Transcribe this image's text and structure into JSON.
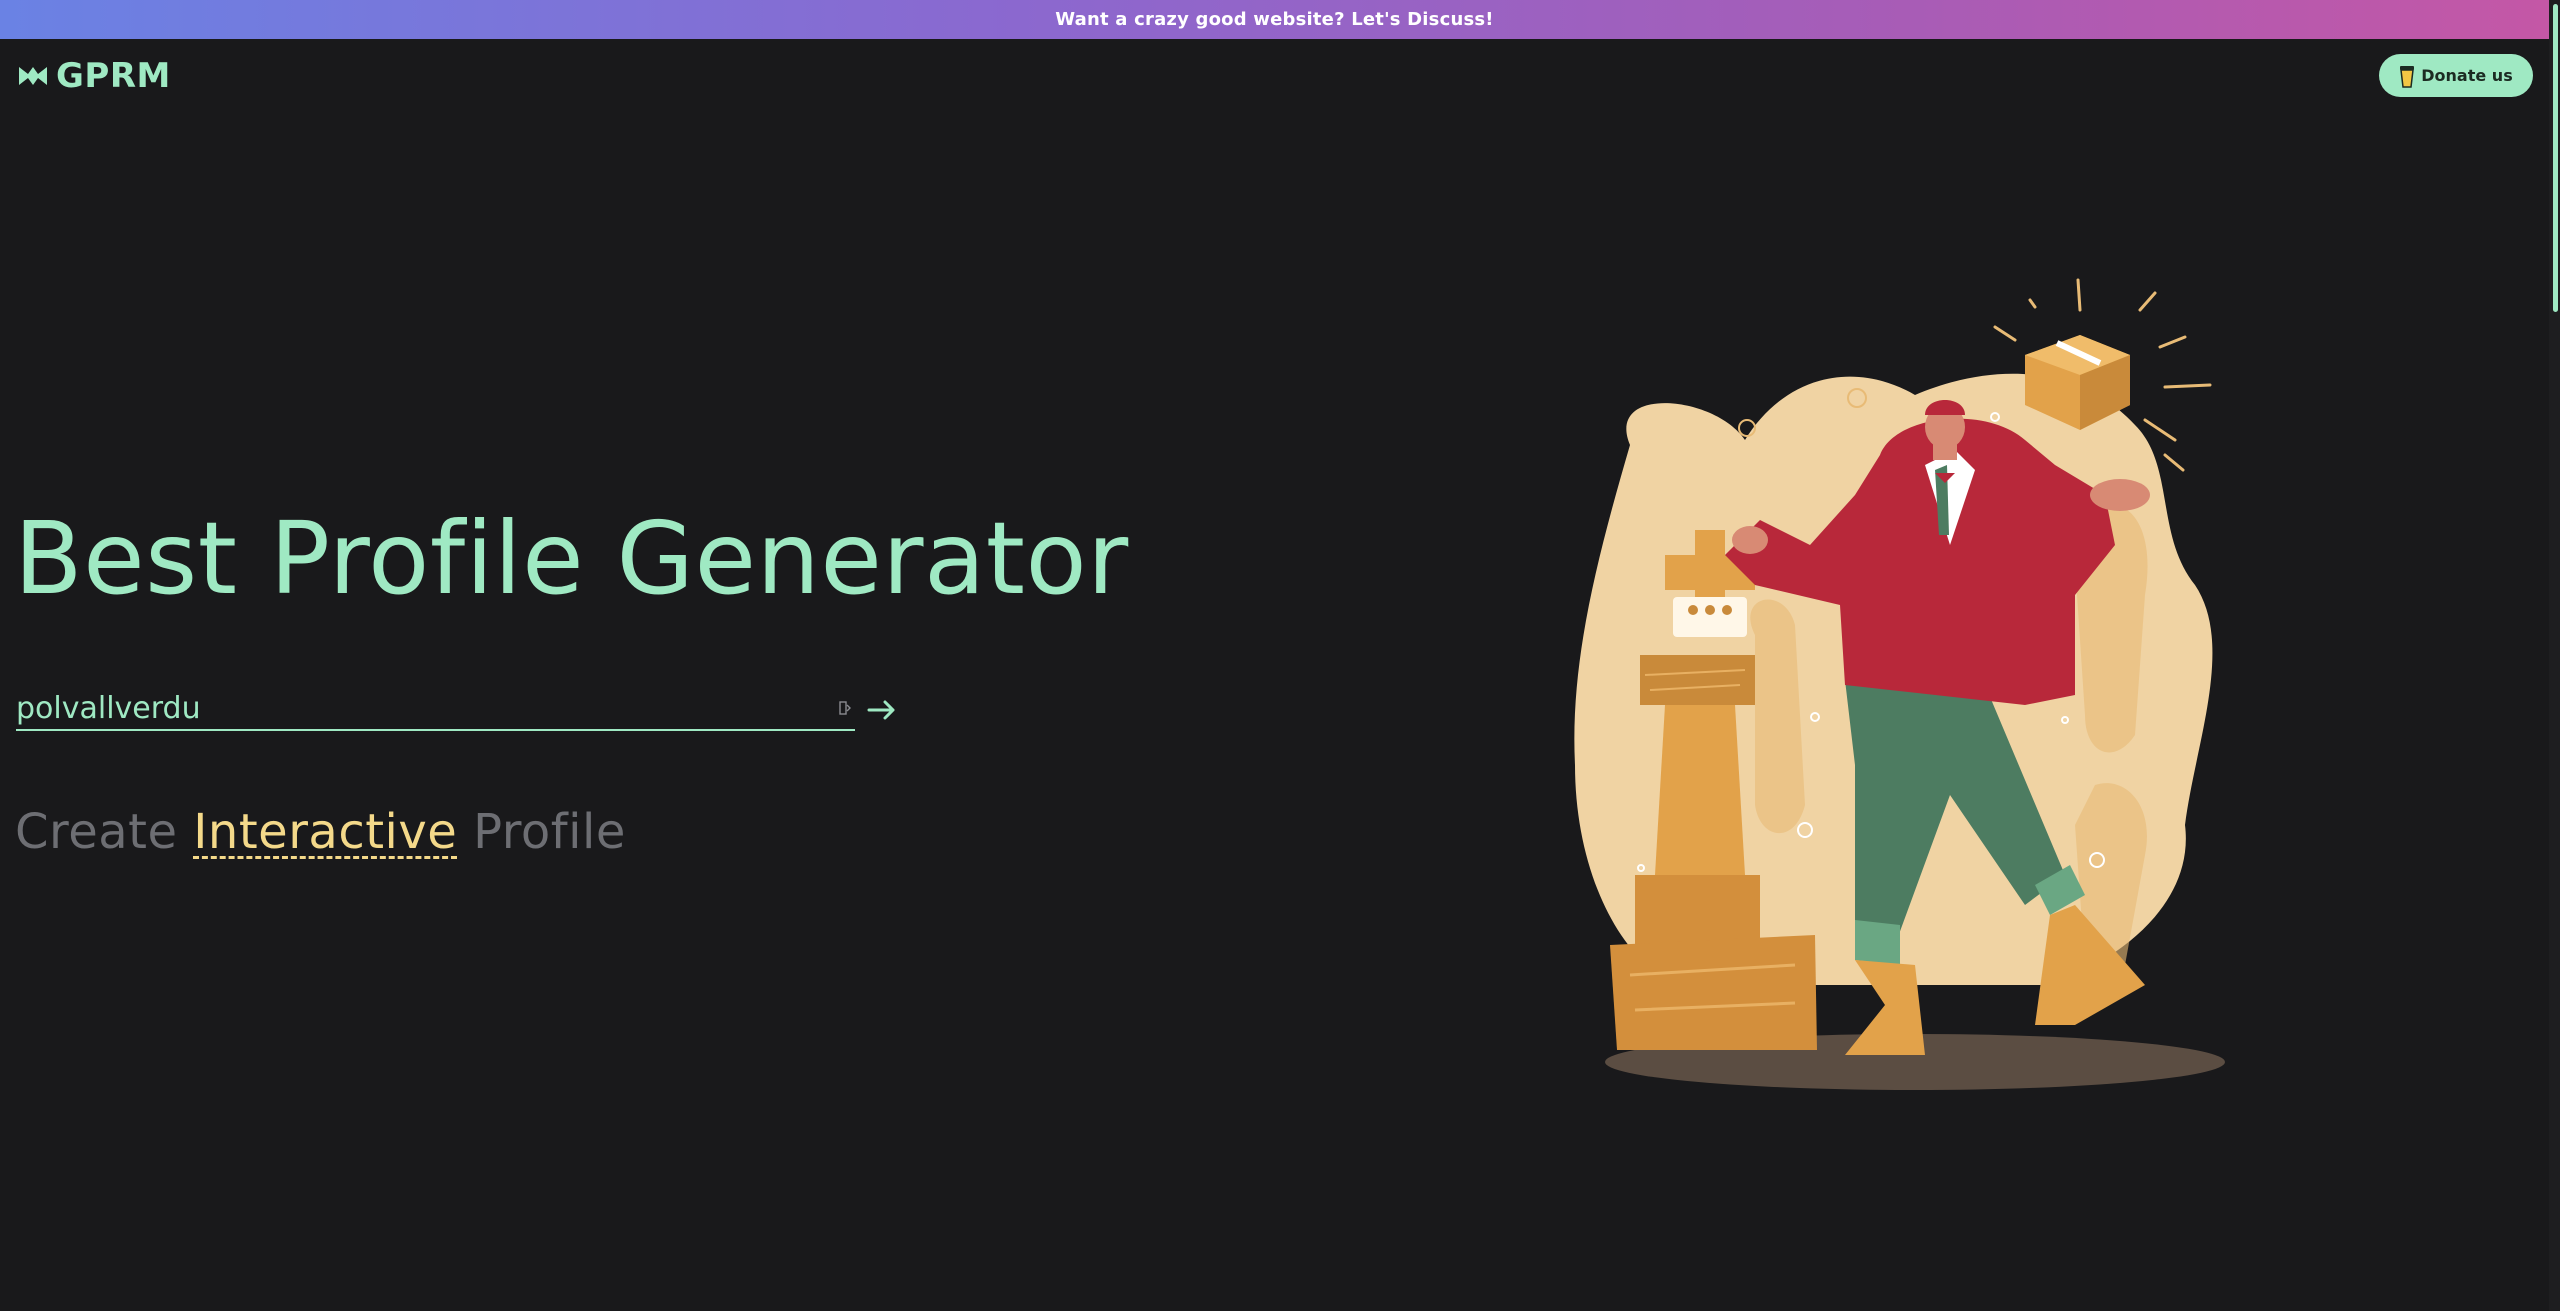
{
  "banner": {
    "text": "Want a crazy good website? Let's Discuss!"
  },
  "header": {
    "logo_text": "GPRM",
    "logo_icon": "crown-icon",
    "donate_label": "Donate us",
    "donate_icon": "coffee-cup-icon"
  },
  "hero": {
    "title": "Best Profile Generator",
    "input_value": "polvallverdu",
    "submit_icon": "arrow-right-icon"
  },
  "tagline": {
    "prefix": "Create",
    "highlight": "Interactive",
    "suffix": "Profile"
  },
  "colors": {
    "accent": "#9fe9c3",
    "background": "#19191b",
    "highlight": "#f4d98a",
    "muted": "#6d6e73"
  }
}
